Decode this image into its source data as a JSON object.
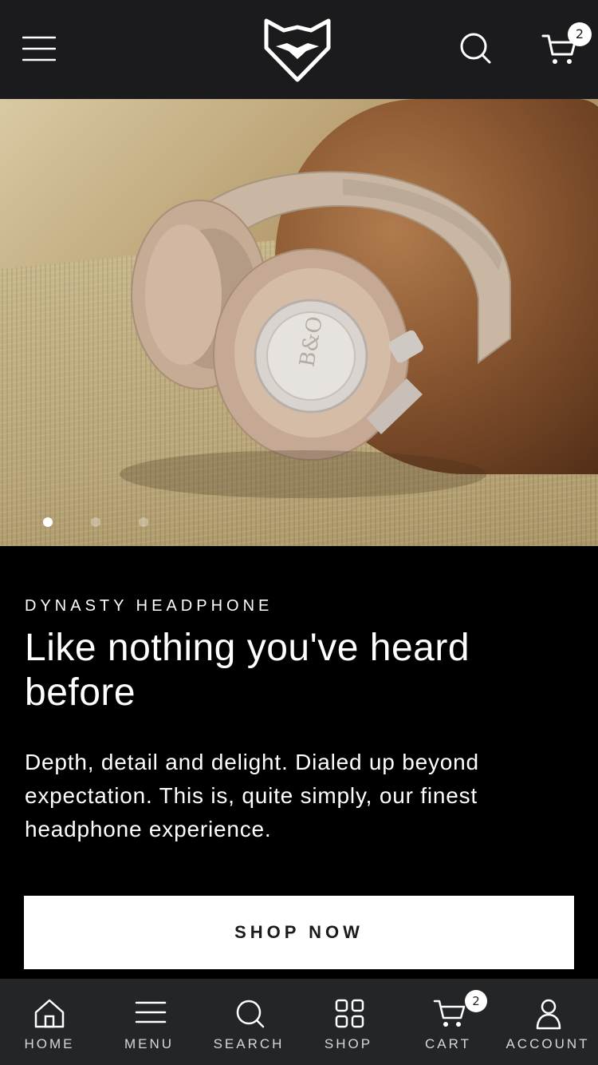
{
  "header": {
    "cart_count": "2"
  },
  "hero": {
    "slides_total": 3,
    "active_slide": 1
  },
  "content": {
    "eyebrow": "DYNASTY HEADPHONE",
    "headline": "Like nothing you've heard before",
    "description": "Depth, detail and delight. Dialed up beyond expectation. This is, quite simply, our finest headphone experience.",
    "cta": "SHOP NOW"
  },
  "bottom_nav": {
    "items": [
      {
        "label": "HOME",
        "icon": "home-icon"
      },
      {
        "label": "MENU",
        "icon": "menu-icon"
      },
      {
        "label": "SEARCH",
        "icon": "search-icon"
      },
      {
        "label": "SHOP",
        "icon": "grid-icon"
      },
      {
        "label": "CART",
        "icon": "cart-icon"
      },
      {
        "label": "ACCOUNT",
        "icon": "user-icon"
      }
    ],
    "cart_count": "2"
  },
  "colors": {
    "header_bg": "#1b1b1e",
    "bottom_nav_bg": "#242527",
    "content_bg": "#000000",
    "button_bg": "#ffffff"
  }
}
